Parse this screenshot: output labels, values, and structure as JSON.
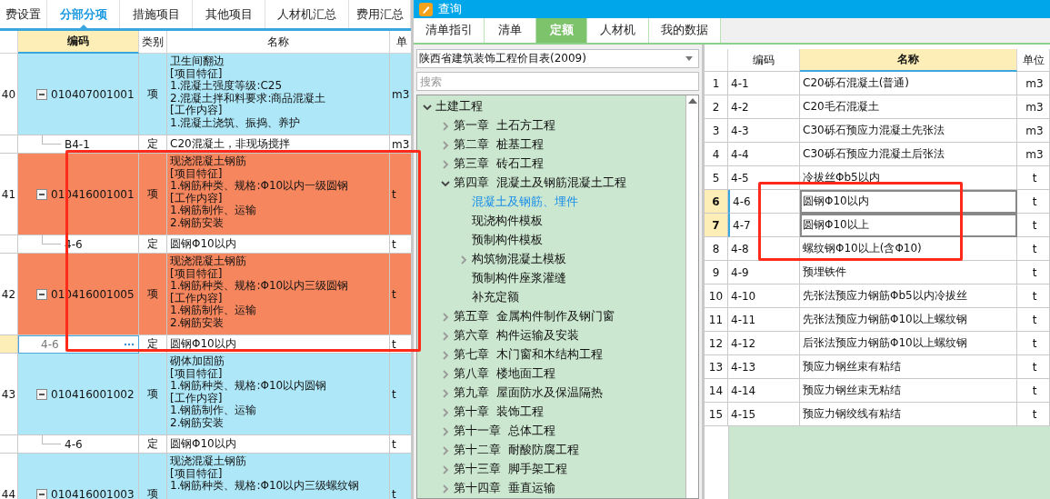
{
  "left_tabs": [
    {
      "label": "费设置",
      "selected": false
    },
    {
      "label": "分部分项",
      "selected": true
    },
    {
      "label": "措施项目",
      "selected": false
    },
    {
      "label": "其他项目",
      "selected": false
    },
    {
      "label": "人材机汇总",
      "selected": false
    },
    {
      "label": "费用汇总",
      "selected": false
    }
  ],
  "bill_table": {
    "columns": [
      {
        "label": "编码",
        "highlighted": true
      },
      {
        "label": "类别",
        "highlighted": false
      },
      {
        "label": "名称",
        "highlighted": false
      },
      {
        "label": "单",
        "highlighted": false
      }
    ],
    "rows": [
      {
        "kind": "item",
        "number": "40",
        "code": "010407001001",
        "category": "项",
        "name_lines": [
          "卫生间翻边",
          "[项目特征]",
          "1.混凝土强度等级:C25",
          "2.混凝土拌和料要求:商品混凝土",
          "[工作内容]",
          "1.混凝土浇筑、振捣、养护"
        ],
        "unit": "m3",
        "color": "#aee8f8"
      },
      {
        "kind": "sub",
        "code": "B4-1",
        "category": "定",
        "name": "C20混凝土，非现场搅拌",
        "unit": "m3",
        "editing": false
      },
      {
        "kind": "item",
        "number": "41",
        "code": "010416001001",
        "category": "项",
        "name_lines": [
          "现浇混凝土钢筋",
          "[项目特征]",
          "1.钢筋种类、规格:Φ10以内一级圆钢",
          "[工作内容]",
          "1.钢筋制作、运输",
          "2.钢筋安装"
        ],
        "unit": "t",
        "color": "#f5865e"
      },
      {
        "kind": "sub",
        "code": "4-6",
        "category": "定",
        "name": "圆钢Φ10以内",
        "unit": "t",
        "editing": false
      },
      {
        "kind": "item",
        "number": "42",
        "code": "010416001005",
        "category": "项",
        "name_lines": [
          "现浇混凝土钢筋",
          "[项目特征]",
          "1.钢筋种类、规格:Φ10以内三级圆钢",
          "[工作内容]",
          "1.钢筋制作、运输",
          "2.钢筋安装"
        ],
        "unit": "t",
        "color": "#f5865e"
      },
      {
        "kind": "sub",
        "code": "4-6",
        "category": "定",
        "name": "圆钢Φ10以内",
        "unit": "t",
        "editing": true
      },
      {
        "kind": "item",
        "number": "43",
        "code": "010416001002",
        "category": "项",
        "name_lines": [
          "砌体加固筋",
          "[项目特征]",
          "1.钢筋种类、规格:Φ10以内圆钢",
          "[工作内容]",
          "1.钢筋制作、运输",
          "2.钢筋安装"
        ],
        "unit": "t",
        "color": "#aee8f8"
      },
      {
        "kind": "sub",
        "code": "4-6",
        "category": "定",
        "name": "圆钢Φ10以内",
        "unit": "t",
        "editing": false
      },
      {
        "kind": "item",
        "number": "44",
        "code": "010416001003",
        "category": "项",
        "name_lines": [
          "现浇混凝土钢筋",
          "[项目特征]",
          "1.钢筋种类、规格:Φ10以内三级螺纹钢"
        ],
        "unit": "t",
        "color": "#aee8f8"
      }
    ]
  },
  "query_window": {
    "title": "查询",
    "tabs": [
      {
        "label": "清单指引",
        "selected": false
      },
      {
        "label": "清单",
        "selected": false
      },
      {
        "label": "定额",
        "selected": true
      },
      {
        "label": "人材机",
        "selected": false
      },
      {
        "label": "我的数据",
        "selected": false
      }
    ],
    "library": "陕西省建筑装饰工程价目表(2009)",
    "search": {
      "placeholder": "搜索"
    },
    "tree": [
      {
        "label": "土建工程",
        "expanded": true,
        "selected": false,
        "children": [
          {
            "label": "第一章  土石方工程",
            "expanded": false,
            "selected": false
          },
          {
            "label": "第二章  桩基工程",
            "expanded": false,
            "selected": false
          },
          {
            "label": "第三章  砖石工程",
            "expanded": false,
            "selected": false
          },
          {
            "label": "第四章  混凝土及钢筋混凝土工程",
            "expanded": true,
            "selected": false,
            "children": [
              {
                "label": "混凝土及钢筋、埋件",
                "selected": true
              },
              {
                "label": "现浇构件模板",
                "selected": false
              },
              {
                "label": "预制构件模板",
                "selected": false
              },
              {
                "label": "构筑物混凝土模板",
                "expanded": false,
                "selected": false
              },
              {
                "label": "预制构件座浆灌缝",
                "selected": false
              },
              {
                "label": "补充定额",
                "selected": false
              }
            ]
          },
          {
            "label": "第五章  金属构件制作及钢门窗",
            "expanded": false,
            "selected": false
          },
          {
            "label": "第六章  构件运输及安装",
            "expanded": false,
            "selected": false
          },
          {
            "label": "第七章  木门窗和木结构工程",
            "expanded": false,
            "selected": false
          },
          {
            "label": "第八章  楼地面工程",
            "expanded": false,
            "selected": false
          },
          {
            "label": "第九章  屋面防水及保温隔热",
            "expanded": false,
            "selected": false
          },
          {
            "label": "第十章  装饰工程",
            "expanded": false,
            "selected": false
          },
          {
            "label": "第十一章  总体工程",
            "expanded": false,
            "selected": false
          },
          {
            "label": "第十二章  耐酸防腐工程",
            "expanded": false,
            "selected": false
          },
          {
            "label": "第十三章  脚手架工程",
            "expanded": false,
            "selected": false
          },
          {
            "label": "第十四章  垂直运输",
            "expanded": false,
            "selected": false
          }
        ]
      }
    ]
  },
  "quota_table": {
    "columns": [
      {
        "label": "编码",
        "highlighted": false
      },
      {
        "label": "名称",
        "highlighted": true
      },
      {
        "label": "单位",
        "highlighted": false
      }
    ],
    "rows": [
      {
        "number": "1",
        "code": "4-1",
        "name": "C20砾石混凝土(普通)",
        "unit": "m3",
        "selected": false
      },
      {
        "number": "2",
        "code": "4-2",
        "name": "C20毛石混凝土",
        "unit": "m3",
        "selected": false
      },
      {
        "number": "3",
        "code": "4-3",
        "name": "C30砾石预应力混凝土先张法",
        "unit": "m3",
        "selected": false
      },
      {
        "number": "4",
        "code": "4-4",
        "name": "C30砾石预应力混凝土后张法",
        "unit": "m3",
        "selected": false
      },
      {
        "number": "5",
        "code": "4-5",
        "name": "冷拔丝Φb5以内",
        "unit": "t",
        "selected": false
      },
      {
        "number": "6",
        "code": "4-6",
        "name": "圆钢Φ10以内",
        "unit": "t",
        "selected": true
      },
      {
        "number": "7",
        "code": "4-7",
        "name": "圆钢Φ10以上",
        "unit": "t",
        "selected": true
      },
      {
        "number": "8",
        "code": "4-8",
        "name": "螺纹钢Φ10以上(含Φ10)",
        "unit": "t",
        "selected": false
      },
      {
        "number": "9",
        "code": "4-9",
        "name": "预埋铁件",
        "unit": "t",
        "selected": false
      },
      {
        "number": "10",
        "code": "4-10",
        "name": "先张法预应力钢筋Φb5以内冷拔丝",
        "unit": "t",
        "selected": false
      },
      {
        "number": "11",
        "code": "4-11",
        "name": "先张法预应力钢筋Φ10以上螺纹钢",
        "unit": "t",
        "selected": false
      },
      {
        "number": "12",
        "code": "4-12",
        "name": "后张法预应力钢筋Φ10以上螺纹钢",
        "unit": "t",
        "selected": false
      },
      {
        "number": "13",
        "code": "4-13",
        "name": "预应力钢丝束有粘结",
        "unit": "t",
        "selected": false
      },
      {
        "number": "14",
        "code": "4-14",
        "name": "预应力钢丝束无粘结",
        "unit": "t",
        "selected": false
      },
      {
        "number": "15",
        "code": "4-15",
        "name": "预应力钢绞线有粘结",
        "unit": "t",
        "selected": false
      }
    ]
  }
}
